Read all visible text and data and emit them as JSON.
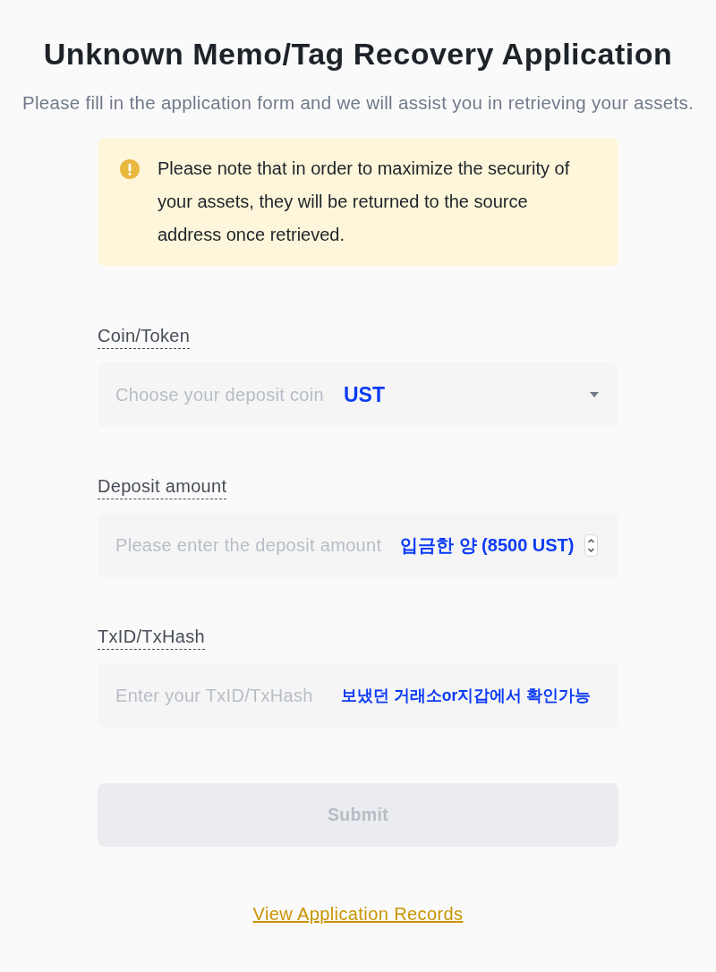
{
  "title": "Unknown Memo/Tag Recovery Application",
  "subtitle": "Please fill in the application form and we will assist you in retrieving your assets.",
  "notice": {
    "text": "Please note that in order to maximize the security of your assets, they will be returned to the source address once retrieved."
  },
  "fields": [
    {
      "kind": "select",
      "label": "Coin/Token",
      "placeholder": "Choose your deposit coin",
      "annotation": "UST"
    },
    {
      "kind": "number",
      "label": "Deposit amount",
      "placeholder": "Please enter the deposit amount",
      "annotation": "입금한 양 (8500 UST)"
    },
    {
      "kind": "text",
      "label": "TxID/TxHash",
      "placeholder": "Enter your TxID/TxHash",
      "annotation": "보냈던 거래소or지갑에서 확인가능"
    }
  ],
  "submit": {
    "label": "Submit",
    "disabled": true
  },
  "records_link": "View Application Records"
}
